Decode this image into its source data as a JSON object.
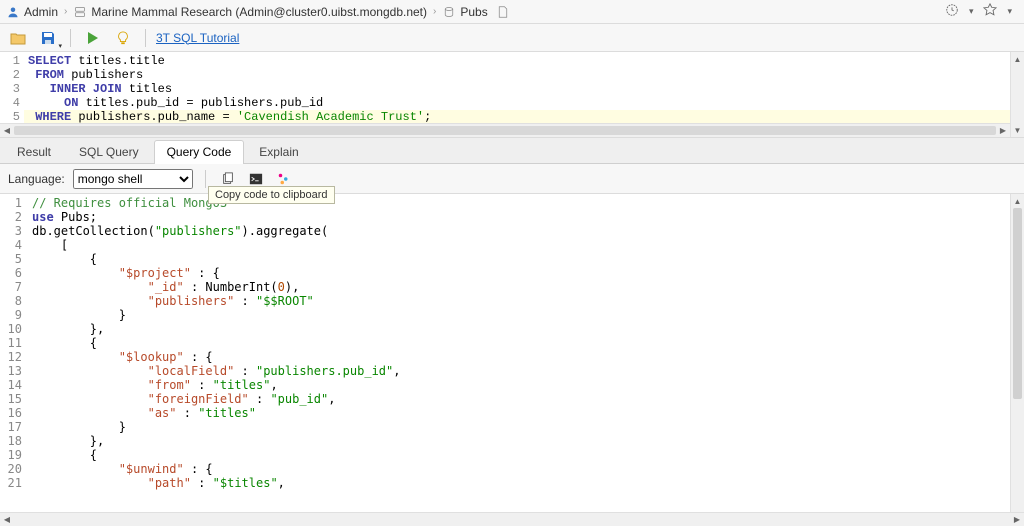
{
  "breadcrumb": {
    "user": "Admin",
    "connection": "Marine Mammal Research (Admin@cluster0.uibst.mongdb.net)",
    "db": "Pubs"
  },
  "toolbar": {
    "tutorial_link": "3T SQL Tutorial"
  },
  "sql": {
    "lines": [
      [
        {
          "t": "SELECT ",
          "c": "kw"
        },
        {
          "t": "titles.title",
          "c": "fn"
        }
      ],
      [
        {
          "t": " FROM ",
          "c": "kw"
        },
        {
          "t": "publishers",
          "c": "fn"
        }
      ],
      [
        {
          "t": "   INNER JOIN ",
          "c": "kw"
        },
        {
          "t": "titles",
          "c": "fn"
        }
      ],
      [
        {
          "t": "     ON ",
          "c": "kw"
        },
        {
          "t": "titles.pub_id = publishers.pub_id",
          "c": "fn"
        }
      ],
      [
        {
          "t": " WHERE ",
          "c": "kw"
        },
        {
          "t": "publishers.pub_name = ",
          "c": "fn"
        },
        {
          "t": "'Cavendish Academic Trust'",
          "c": "str"
        },
        {
          "t": ";",
          "c": "fn"
        }
      ]
    ]
  },
  "tabs": {
    "items": [
      "Result",
      "SQL Query",
      "Query Code",
      "Explain"
    ],
    "active": 2
  },
  "lang_bar": {
    "label": "Language:",
    "selected": "mongo shell",
    "tooltip": "Copy code to clipboard"
  },
  "code": {
    "lines": [
      [
        {
          "t": "// Requires official MongoS",
          "c": "comment"
        }
      ],
      [
        {
          "t": "use ",
          "c": "kw"
        },
        {
          "t": "Pubs;",
          "c": "fn"
        }
      ],
      [
        {
          "t": "db.getCollection(",
          "c": "fn"
        },
        {
          "t": "\"publishers\"",
          "c": "str"
        },
        {
          "t": ").aggregate(",
          "c": "fn"
        }
      ],
      [
        {
          "t": "    [",
          "c": "fn"
        }
      ],
      [
        {
          "t": "        {",
          "c": "fn"
        }
      ],
      [
        {
          "t": "            ",
          "c": "fn"
        },
        {
          "t": "\"$project\"",
          "c": "key"
        },
        {
          "t": " : {",
          "c": "fn"
        }
      ],
      [
        {
          "t": "                ",
          "c": "fn"
        },
        {
          "t": "\"_id\"",
          "c": "key"
        },
        {
          "t": " : NumberInt(",
          "c": "fn"
        },
        {
          "t": "0",
          "c": "num"
        },
        {
          "t": "),",
          "c": "fn"
        }
      ],
      [
        {
          "t": "                ",
          "c": "fn"
        },
        {
          "t": "\"publishers\"",
          "c": "key"
        },
        {
          "t": " : ",
          "c": "fn"
        },
        {
          "t": "\"$$ROOT\"",
          "c": "str"
        }
      ],
      [
        {
          "t": "            }",
          "c": "fn"
        }
      ],
      [
        {
          "t": "        },",
          "c": "fn"
        }
      ],
      [
        {
          "t": "        {",
          "c": "fn"
        }
      ],
      [
        {
          "t": "            ",
          "c": "fn"
        },
        {
          "t": "\"$lookup\"",
          "c": "key"
        },
        {
          "t": " : {",
          "c": "fn"
        }
      ],
      [
        {
          "t": "                ",
          "c": "fn"
        },
        {
          "t": "\"localField\"",
          "c": "key"
        },
        {
          "t": " : ",
          "c": "fn"
        },
        {
          "t": "\"publishers.pub_id\"",
          "c": "str"
        },
        {
          "t": ",",
          "c": "fn"
        }
      ],
      [
        {
          "t": "                ",
          "c": "fn"
        },
        {
          "t": "\"from\"",
          "c": "key"
        },
        {
          "t": " : ",
          "c": "fn"
        },
        {
          "t": "\"titles\"",
          "c": "str"
        },
        {
          "t": ",",
          "c": "fn"
        }
      ],
      [
        {
          "t": "                ",
          "c": "fn"
        },
        {
          "t": "\"foreignField\"",
          "c": "key"
        },
        {
          "t": " : ",
          "c": "fn"
        },
        {
          "t": "\"pub_id\"",
          "c": "str"
        },
        {
          "t": ",",
          "c": "fn"
        }
      ],
      [
        {
          "t": "                ",
          "c": "fn"
        },
        {
          "t": "\"as\"",
          "c": "key"
        },
        {
          "t": " : ",
          "c": "fn"
        },
        {
          "t": "\"titles\"",
          "c": "str"
        }
      ],
      [
        {
          "t": "            }",
          "c": "fn"
        }
      ],
      [
        {
          "t": "        },",
          "c": "fn"
        }
      ],
      [
        {
          "t": "        {",
          "c": "fn"
        }
      ],
      [
        {
          "t": "            ",
          "c": "fn"
        },
        {
          "t": "\"$unwind\"",
          "c": "key"
        },
        {
          "t": " : {",
          "c": "fn"
        }
      ],
      [
        {
          "t": "                ",
          "c": "fn"
        },
        {
          "t": "\"path\"",
          "c": "key"
        },
        {
          "t": " : ",
          "c": "fn"
        },
        {
          "t": "\"$titles\"",
          "c": "str"
        },
        {
          "t": ",",
          "c": "fn"
        }
      ]
    ]
  }
}
